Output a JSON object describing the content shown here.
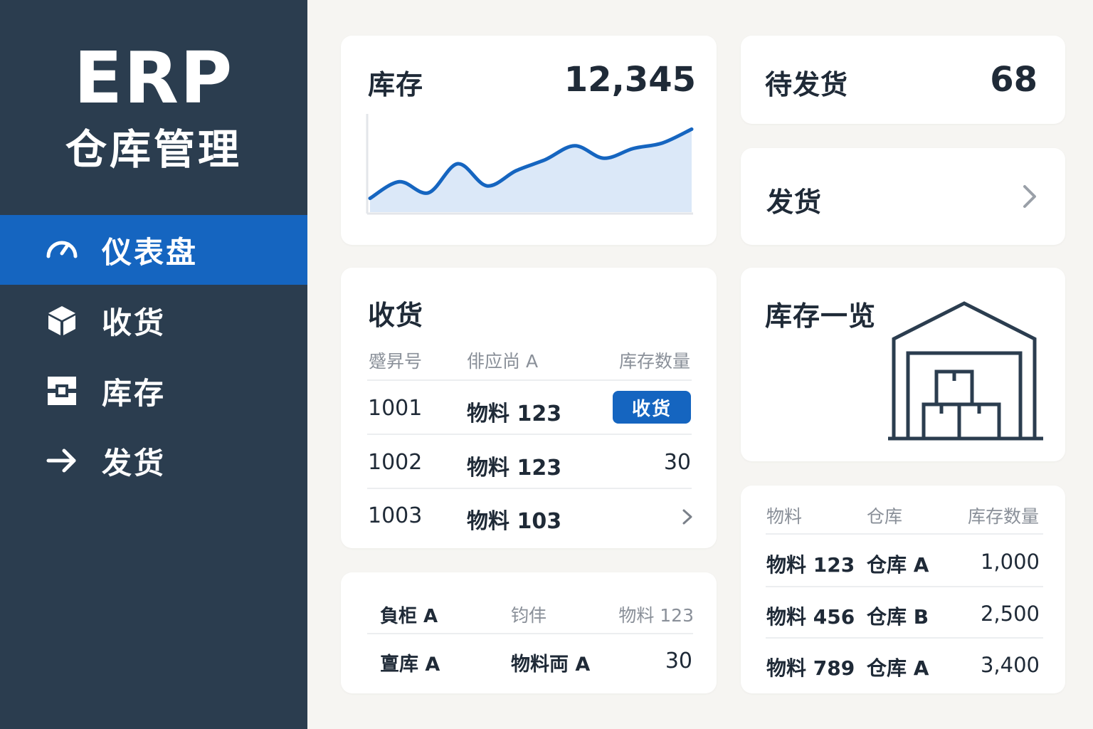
{
  "brand": {
    "title": "ERP",
    "subtitle": "仓库管理"
  },
  "sidebar": {
    "items": [
      {
        "label": "仪表盘",
        "icon": "gauge-icon",
        "active": true
      },
      {
        "label": "收货",
        "icon": "box-icon",
        "active": false
      },
      {
        "label": "库存",
        "icon": "inventory-icon",
        "active": false
      },
      {
        "label": "发货",
        "icon": "arrow-right-icon",
        "active": false
      }
    ]
  },
  "inventory_card": {
    "title": "库存",
    "value": "12,345"
  },
  "pending_card": {
    "title": "待发货",
    "value": "68"
  },
  "ship_card": {
    "title": "发货",
    "icon": "chevron-right-icon"
  },
  "overview_card": {
    "title": "库存一览",
    "icon": "warehouse-icon"
  },
  "receiving": {
    "title": "收货",
    "headers": [
      "蹙昇号",
      "俳应尚 A",
      "库存数量"
    ],
    "rows": [
      {
        "id": "1001",
        "item": "物料 123",
        "action": "收货"
      },
      {
        "id": "1002",
        "item": "物料 123",
        "qty": "30"
      },
      {
        "id": "1003",
        "item": "物料 103",
        "icon": "chevron-right-icon"
      }
    ]
  },
  "bottom_table": {
    "headers": [
      "負柜 A",
      "钧仹",
      "物料 123"
    ],
    "rows": [
      {
        "c1": "亶库 A",
        "c2": "物料両 A",
        "c3": "30"
      }
    ]
  },
  "stock_table": {
    "headers": [
      "物料",
      "仓库",
      "库存数量"
    ],
    "rows": [
      {
        "item": "物料 123",
        "warehouse": "仓库 A",
        "qty": "1,000"
      },
      {
        "item": "物料 456",
        "warehouse": "仓库 B",
        "qty": "2,500"
      },
      {
        "item": "物料 789",
        "warehouse": "仓库 A",
        "qty": "3,400"
      }
    ]
  },
  "chart_data": {
    "type": "area",
    "values": [
      10,
      22,
      14,
      35,
      19,
      30,
      38,
      48,
      39,
      46,
      50,
      60
    ],
    "ylim": [
      0,
      70
    ],
    "grid": false,
    "colors": {
      "line": "#1565c0",
      "fill": "#dbe8f8"
    }
  },
  "colors": {
    "accent": "#1565c0",
    "sidebar": "#2b3d4f",
    "background": "#f6f5f2"
  }
}
